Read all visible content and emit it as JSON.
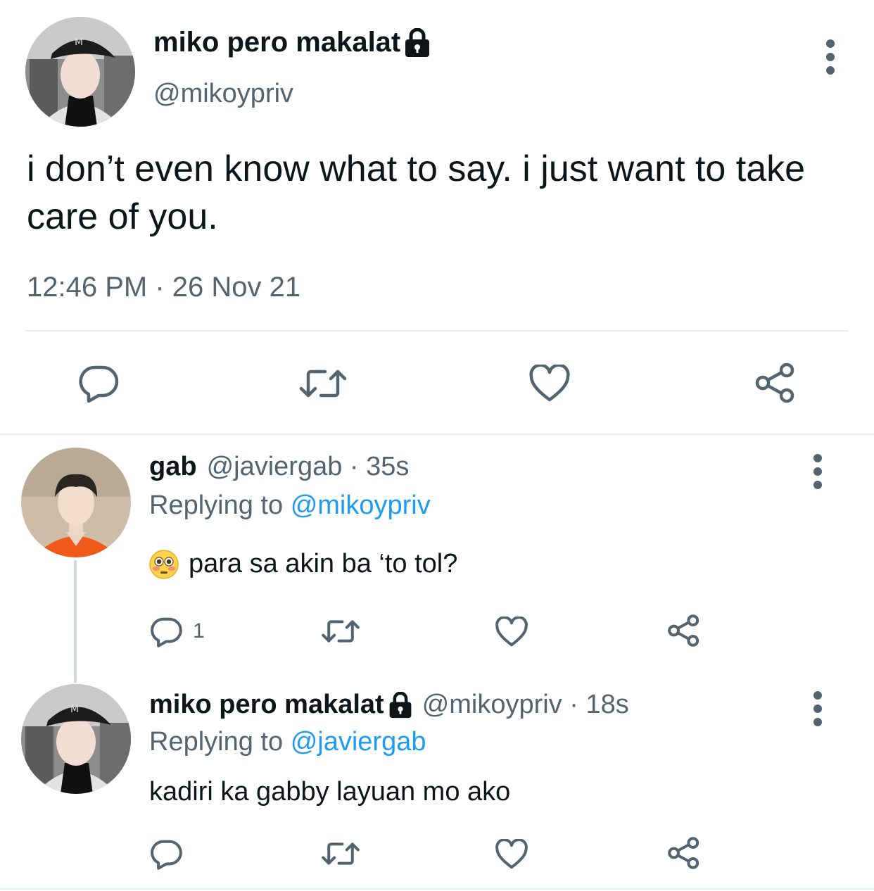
{
  "main_tweet": {
    "display_name": "miko pero makalat",
    "handle": "@mikoypriv",
    "text": "i don’t even know what to say. i just want to take care of you.",
    "timestamp": "12:46 PM · 26 Nov 21",
    "icons": [
      "lock-icon",
      "more-icon",
      "reply-icon",
      "retweet-icon",
      "like-icon",
      "share-icon"
    ]
  },
  "replies": [
    {
      "display_name": "gab",
      "handle_time": "@javiergab · 35s",
      "replying_prefix": "Replying to",
      "replying_to": "@mikoypriv",
      "emoji": "flushed-face-icon",
      "text": "para sa akin ba ‘to tol?",
      "reply_count": "1"
    },
    {
      "display_name": "miko pero makalat",
      "handle_time": "@mikoypriv · 18s",
      "replying_prefix": "Replying to",
      "replying_to": "@javiergab",
      "text": "kadiri ka gabby layuan mo ako"
    }
  ],
  "colors": {
    "text_primary": "#0f1419",
    "text_secondary": "#536471",
    "accent_blue": "#1d9bf0",
    "divider": "#e6ebee"
  }
}
